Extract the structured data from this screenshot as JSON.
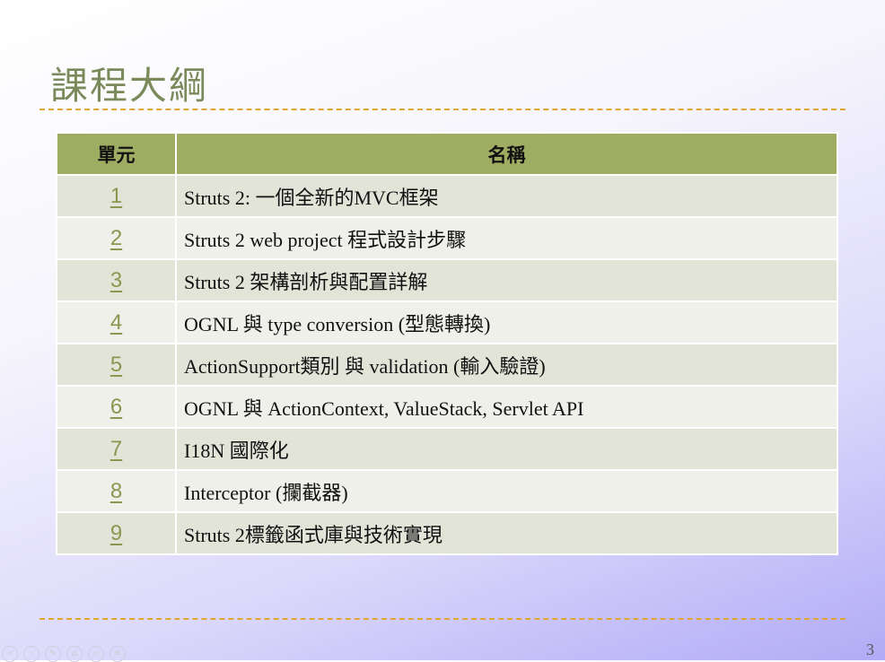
{
  "slide": {
    "title": "課程大綱",
    "page_number": "3"
  },
  "table": {
    "headers": [
      "單元",
      "名稱"
    ],
    "rows": [
      {
        "unit": "1",
        "name": "Struts 2: 一個全新的MVC框架"
      },
      {
        "unit": "2",
        "name": "Struts 2 web project 程式設計步驟"
      },
      {
        "unit": "3",
        "name": "Struts 2 架構剖析與配置詳解"
      },
      {
        "unit": "4",
        "name": "OGNL 與 type conversion (型態轉換)"
      },
      {
        "unit": "5",
        "name": "ActionSupport類別 與 validation (輸入驗證)"
      },
      {
        "unit": "6",
        "name": "OGNL 與 ActionContext, ValueStack, Servlet API"
      },
      {
        "unit": "7",
        "name": "I18N 國際化"
      },
      {
        "unit": "8",
        "name": "Interceptor (攔截器)"
      },
      {
        "unit": "9",
        "name": "Struts 2標籤函式庫與技術實現"
      }
    ]
  },
  "nav_icons": [
    "previous-icon",
    "next-icon",
    "pen-icon",
    "home-icon",
    "zoom-icon",
    "menu-icon"
  ],
  "colors": {
    "title": "#7b8a5a",
    "header": "#9fad62",
    "rule": "#e0a634",
    "link": "#8c9650"
  }
}
